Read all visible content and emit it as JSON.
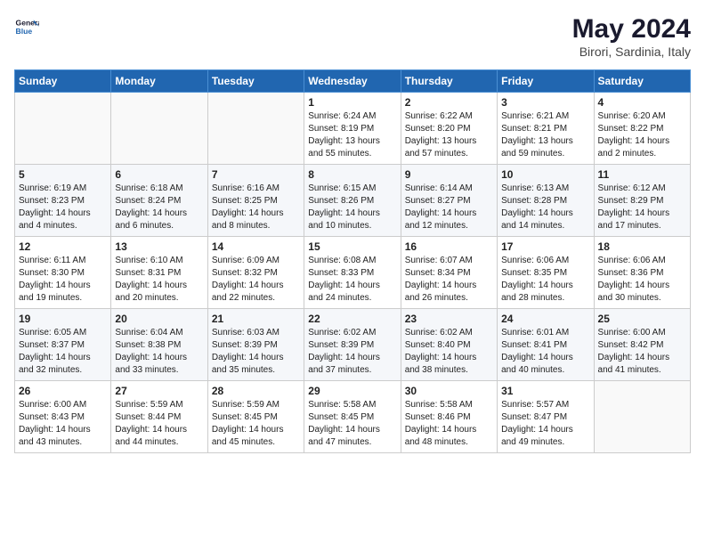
{
  "header": {
    "logo_line1": "General",
    "logo_line2": "Blue",
    "month_year": "May 2024",
    "location": "Birori, Sardinia, Italy"
  },
  "days_of_week": [
    "Sunday",
    "Monday",
    "Tuesday",
    "Wednesday",
    "Thursday",
    "Friday",
    "Saturday"
  ],
  "weeks": [
    [
      {
        "day": "",
        "content": ""
      },
      {
        "day": "",
        "content": ""
      },
      {
        "day": "",
        "content": ""
      },
      {
        "day": "1",
        "content": "Sunrise: 6:24 AM\nSunset: 8:19 PM\nDaylight: 13 hours and 55 minutes."
      },
      {
        "day": "2",
        "content": "Sunrise: 6:22 AM\nSunset: 8:20 PM\nDaylight: 13 hours and 57 minutes."
      },
      {
        "day": "3",
        "content": "Sunrise: 6:21 AM\nSunset: 8:21 PM\nDaylight: 13 hours and 59 minutes."
      },
      {
        "day": "4",
        "content": "Sunrise: 6:20 AM\nSunset: 8:22 PM\nDaylight: 14 hours and 2 minutes."
      }
    ],
    [
      {
        "day": "5",
        "content": "Sunrise: 6:19 AM\nSunset: 8:23 PM\nDaylight: 14 hours and 4 minutes."
      },
      {
        "day": "6",
        "content": "Sunrise: 6:18 AM\nSunset: 8:24 PM\nDaylight: 14 hours and 6 minutes."
      },
      {
        "day": "7",
        "content": "Sunrise: 6:16 AM\nSunset: 8:25 PM\nDaylight: 14 hours and 8 minutes."
      },
      {
        "day": "8",
        "content": "Sunrise: 6:15 AM\nSunset: 8:26 PM\nDaylight: 14 hours and 10 minutes."
      },
      {
        "day": "9",
        "content": "Sunrise: 6:14 AM\nSunset: 8:27 PM\nDaylight: 14 hours and 12 minutes."
      },
      {
        "day": "10",
        "content": "Sunrise: 6:13 AM\nSunset: 8:28 PM\nDaylight: 14 hours and 14 minutes."
      },
      {
        "day": "11",
        "content": "Sunrise: 6:12 AM\nSunset: 8:29 PM\nDaylight: 14 hours and 17 minutes."
      }
    ],
    [
      {
        "day": "12",
        "content": "Sunrise: 6:11 AM\nSunset: 8:30 PM\nDaylight: 14 hours and 19 minutes."
      },
      {
        "day": "13",
        "content": "Sunrise: 6:10 AM\nSunset: 8:31 PM\nDaylight: 14 hours and 20 minutes."
      },
      {
        "day": "14",
        "content": "Sunrise: 6:09 AM\nSunset: 8:32 PM\nDaylight: 14 hours and 22 minutes."
      },
      {
        "day": "15",
        "content": "Sunrise: 6:08 AM\nSunset: 8:33 PM\nDaylight: 14 hours and 24 minutes."
      },
      {
        "day": "16",
        "content": "Sunrise: 6:07 AM\nSunset: 8:34 PM\nDaylight: 14 hours and 26 minutes."
      },
      {
        "day": "17",
        "content": "Sunrise: 6:06 AM\nSunset: 8:35 PM\nDaylight: 14 hours and 28 minutes."
      },
      {
        "day": "18",
        "content": "Sunrise: 6:06 AM\nSunset: 8:36 PM\nDaylight: 14 hours and 30 minutes."
      }
    ],
    [
      {
        "day": "19",
        "content": "Sunrise: 6:05 AM\nSunset: 8:37 PM\nDaylight: 14 hours and 32 minutes."
      },
      {
        "day": "20",
        "content": "Sunrise: 6:04 AM\nSunset: 8:38 PM\nDaylight: 14 hours and 33 minutes."
      },
      {
        "day": "21",
        "content": "Sunrise: 6:03 AM\nSunset: 8:39 PM\nDaylight: 14 hours and 35 minutes."
      },
      {
        "day": "22",
        "content": "Sunrise: 6:02 AM\nSunset: 8:39 PM\nDaylight: 14 hours and 37 minutes."
      },
      {
        "day": "23",
        "content": "Sunrise: 6:02 AM\nSunset: 8:40 PM\nDaylight: 14 hours and 38 minutes."
      },
      {
        "day": "24",
        "content": "Sunrise: 6:01 AM\nSunset: 8:41 PM\nDaylight: 14 hours and 40 minutes."
      },
      {
        "day": "25",
        "content": "Sunrise: 6:00 AM\nSunset: 8:42 PM\nDaylight: 14 hours and 41 minutes."
      }
    ],
    [
      {
        "day": "26",
        "content": "Sunrise: 6:00 AM\nSunset: 8:43 PM\nDaylight: 14 hours and 43 minutes."
      },
      {
        "day": "27",
        "content": "Sunrise: 5:59 AM\nSunset: 8:44 PM\nDaylight: 14 hours and 44 minutes."
      },
      {
        "day": "28",
        "content": "Sunrise: 5:59 AM\nSunset: 8:45 PM\nDaylight: 14 hours and 45 minutes."
      },
      {
        "day": "29",
        "content": "Sunrise: 5:58 AM\nSunset: 8:45 PM\nDaylight: 14 hours and 47 minutes."
      },
      {
        "day": "30",
        "content": "Sunrise: 5:58 AM\nSunset: 8:46 PM\nDaylight: 14 hours and 48 minutes."
      },
      {
        "day": "31",
        "content": "Sunrise: 5:57 AM\nSunset: 8:47 PM\nDaylight: 14 hours and 49 minutes."
      },
      {
        "day": "",
        "content": ""
      }
    ]
  ]
}
